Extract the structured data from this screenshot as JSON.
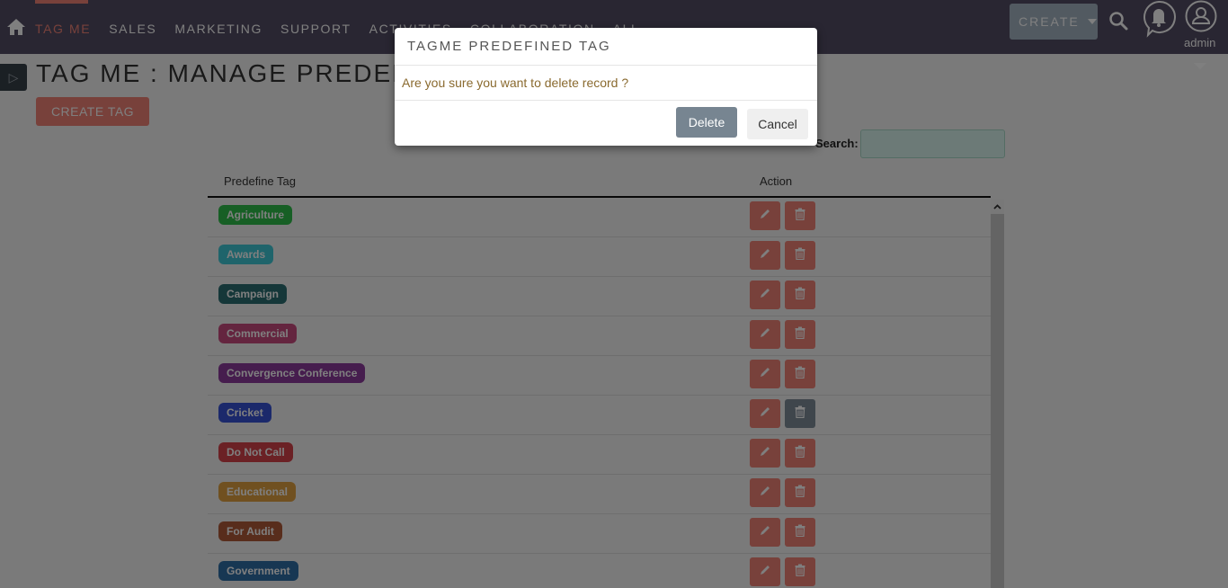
{
  "navbar": {
    "items": [
      {
        "label": "TAG ME",
        "active": true
      },
      {
        "label": "SALES",
        "active": false
      },
      {
        "label": "MARKETING",
        "active": false
      },
      {
        "label": "SUPPORT",
        "active": false
      },
      {
        "label": "ACTIVITIES",
        "active": false
      },
      {
        "label": "COLLABORATION",
        "active": false
      },
      {
        "label": "ALL",
        "active": false
      }
    ],
    "create_label": "CREATE",
    "user_label": "admin",
    "icons": [
      "home-icon",
      "search-icon",
      "bell-icon",
      "user-icon"
    ]
  },
  "page": {
    "title": "TAG ME : MANAGE PREDEFINED TAG",
    "create_tag_label": "CREATE TAG",
    "search_label": "Search:",
    "search_value": ""
  },
  "table": {
    "headers": {
      "tag": "Predefine Tag",
      "action": "Action"
    },
    "rows": [
      {
        "name": "Agriculture",
        "color": "#2fbf4a"
      },
      {
        "name": "Awards",
        "color": "#3ec8d6"
      },
      {
        "name": "Campaign",
        "color": "#2b6f73"
      },
      {
        "name": "Commercial",
        "color": "#c94a7e"
      },
      {
        "name": "Convergence Conference",
        "color": "#8c3a9c"
      },
      {
        "name": "Cricket",
        "color": "#3653d6"
      },
      {
        "name": "Do Not Call",
        "color": "#d6434a"
      },
      {
        "name": "Educational",
        "color": "#e0a040"
      },
      {
        "name": "For Audit",
        "color": "#b05a38"
      },
      {
        "name": "Government",
        "color": "#2f6ea6"
      }
    ],
    "hover_delete_row": 5
  },
  "modal": {
    "title": "TAGME PREDEFINED TAG",
    "message": "Are you sure you want to delete record ?",
    "delete_label": "Delete",
    "cancel_label": "Cancel"
  },
  "colors": {
    "navbar": "#534d64",
    "accent": "#f08377",
    "create_button": "#a5b5c3",
    "delete_button": "#778591"
  }
}
